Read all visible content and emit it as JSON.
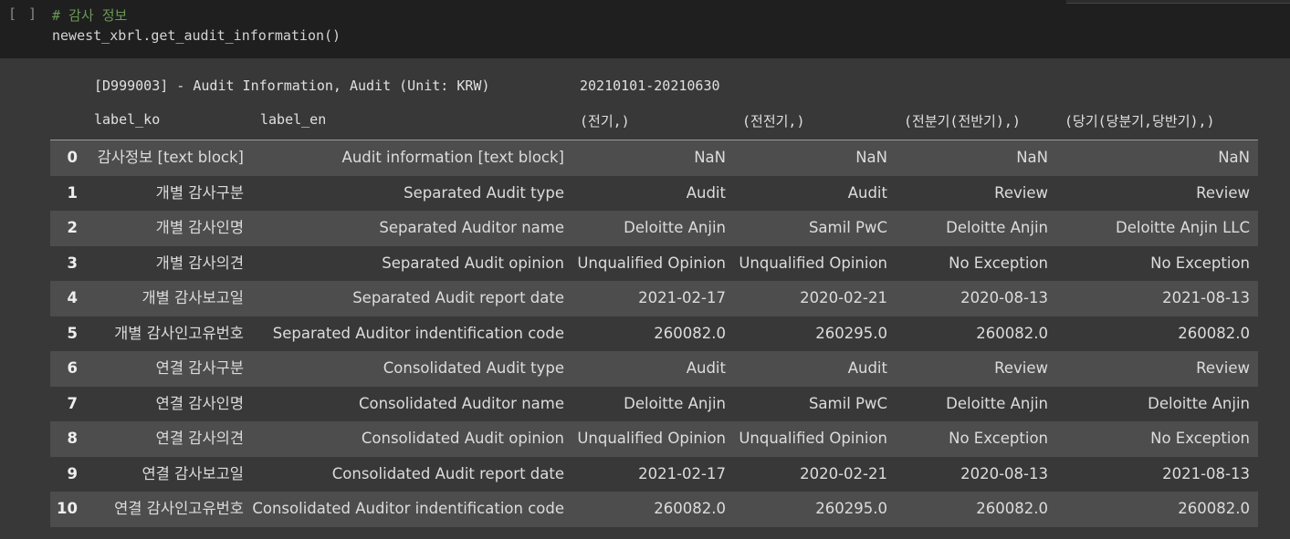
{
  "cell": {
    "run_indicator": "[ ]",
    "code_lines": [
      "# 감사 정보",
      "newest_xbrl.get_audit_information()"
    ]
  },
  "output": {
    "header": {
      "title": "[D999003] - Audit Information, Audit (Unit: KRW)",
      "period": "20210101-20210630"
    },
    "columns": [
      "label_ko",
      "label_en",
      "(전기,)",
      "(전전기,)",
      "(전분기(전반기),)",
      "(당기(당분기,당반기),)"
    ],
    "rows": [
      {
        "idx": "0",
        "ko": "감사정보 [text block]",
        "en": "Audit information [text block]",
        "v1": "NaN",
        "v2": "NaN",
        "v3": "NaN",
        "v4": "NaN"
      },
      {
        "idx": "1",
        "ko": "개별 감사구분",
        "en": "Separated Audit type",
        "v1": "Audit",
        "v2": "Audit",
        "v3": "Review",
        "v4": "Review"
      },
      {
        "idx": "2",
        "ko": "개별 감사인명",
        "en": "Separated Auditor name",
        "v1": "Deloitte Anjin",
        "v2": "Samil PwC",
        "v3": "Deloitte Anjin",
        "v4": "Deloitte Anjin LLC"
      },
      {
        "idx": "3",
        "ko": "개별 감사의견",
        "en": "Separated Audit opinion",
        "v1": "Unqualified Opinion",
        "v2": "Unqualified Opinion",
        "v3": "No Exception",
        "v4": "No Exception"
      },
      {
        "idx": "4",
        "ko": "개별 감사보고일",
        "en": "Separated Audit report date",
        "v1": "2021-02-17",
        "v2": "2020-02-21",
        "v3": "2020-08-13",
        "v4": "2021-08-13"
      },
      {
        "idx": "5",
        "ko": "개별 감사인고유번호",
        "en": "Separated Auditor indentification code",
        "v1": "260082.0",
        "v2": "260295.0",
        "v3": "260082.0",
        "v4": "260082.0"
      },
      {
        "idx": "6",
        "ko": "연결 감사구분",
        "en": "Consolidated Audit type",
        "v1": "Audit",
        "v2": "Audit",
        "v3": "Review",
        "v4": "Review"
      },
      {
        "idx": "7",
        "ko": "연결 감사인명",
        "en": "Consolidated Auditor name",
        "v1": "Deloitte Anjin",
        "v2": "Samil PwC",
        "v3": "Deloitte Anjin",
        "v4": "Deloitte Anjin"
      },
      {
        "idx": "8",
        "ko": "연결 감사의견",
        "en": "Consolidated Audit opinion",
        "v1": "Unqualified Opinion",
        "v2": "Unqualified Opinion",
        "v3": "No Exception",
        "v4": "No Exception"
      },
      {
        "idx": "9",
        "ko": "연결 감사보고일",
        "en": "Consolidated Audit report date",
        "v1": "2021-02-17",
        "v2": "2020-02-21",
        "v3": "2020-08-13",
        "v4": "2021-08-13"
      },
      {
        "idx": "10",
        "ko": "연결 감사인고유번호",
        "en": "Consolidated Auditor indentification code",
        "v1": "260082.0",
        "v2": "260295.0",
        "v3": "260082.0",
        "v4": "260082.0"
      }
    ]
  }
}
